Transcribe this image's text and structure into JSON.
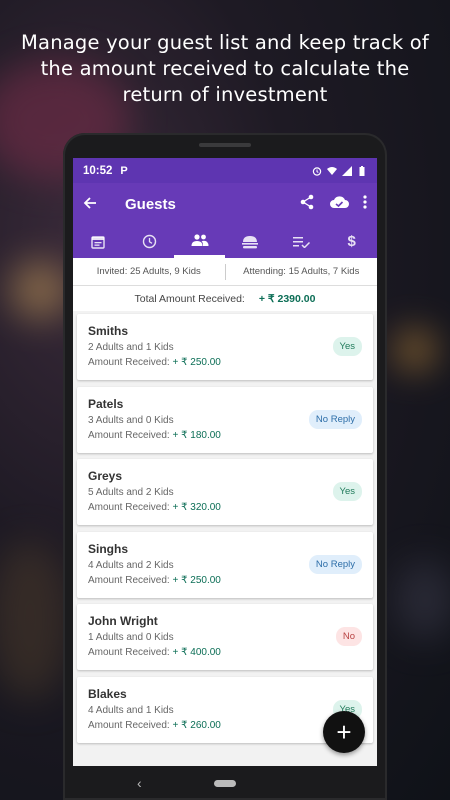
{
  "promo_text": "Manage your guest list and keep track of the amount received to calculate the return of investment",
  "status": {
    "time": "10:52",
    "app_badge": "P"
  },
  "appbar": {
    "title": "Guests",
    "back_icon": "arrow-back-icon",
    "share_icon": "share-icon",
    "cloud_icon": "cloud-done-icon",
    "menu_icon": "more-vert-icon"
  },
  "tabs": [
    {
      "icon": "calendar-icon"
    },
    {
      "icon": "clock-icon"
    },
    {
      "icon": "people-icon",
      "active": true
    },
    {
      "icon": "food-icon"
    },
    {
      "icon": "checklist-icon"
    },
    {
      "icon": "dollar-icon"
    }
  ],
  "summary": {
    "invited": "Invited: 25 Adults, 9 Kids",
    "attending": "Attending: 15 Adults, 7 Kids"
  },
  "total": {
    "label": "Total Amount Received:",
    "value": "+ ₹ 2390.00"
  },
  "guests": [
    {
      "name": "Smiths",
      "counts": "2 Adults and 1 Kids",
      "amount_label": "Amount Received:",
      "amount": "+ ₹ 250.00",
      "status": "Yes"
    },
    {
      "name": "Patels",
      "counts": "3 Adults and 0 Kids",
      "amount_label": "Amount Received:",
      "amount": "+ ₹ 180.00",
      "status": "No Reply"
    },
    {
      "name": "Greys",
      "counts": "5 Adults and 2 Kids",
      "amount_label": "Amount Received:",
      "amount": "+ ₹ 320.00",
      "status": "Yes"
    },
    {
      "name": "Singhs",
      "counts": "4 Adults and 2 Kids",
      "amount_label": "Amount Received:",
      "amount": "+ ₹ 250.00",
      "status": "No Reply"
    },
    {
      "name": "John Wright",
      "counts": "1 Adults and 0 Kids",
      "amount_label": "Amount Received:",
      "amount": "+ ₹ 400.00",
      "status": "No"
    },
    {
      "name": "Blakes",
      "counts": "4 Adults and 1 Kids",
      "amount_label": "Amount Received:",
      "amount": "+ ₹ 260.00",
      "status": "Yes"
    }
  ],
  "fab_label": "+",
  "colors": {
    "primary": "#673ab7",
    "status_bar": "#5e35b1",
    "amount_green": "#0c6e56"
  }
}
